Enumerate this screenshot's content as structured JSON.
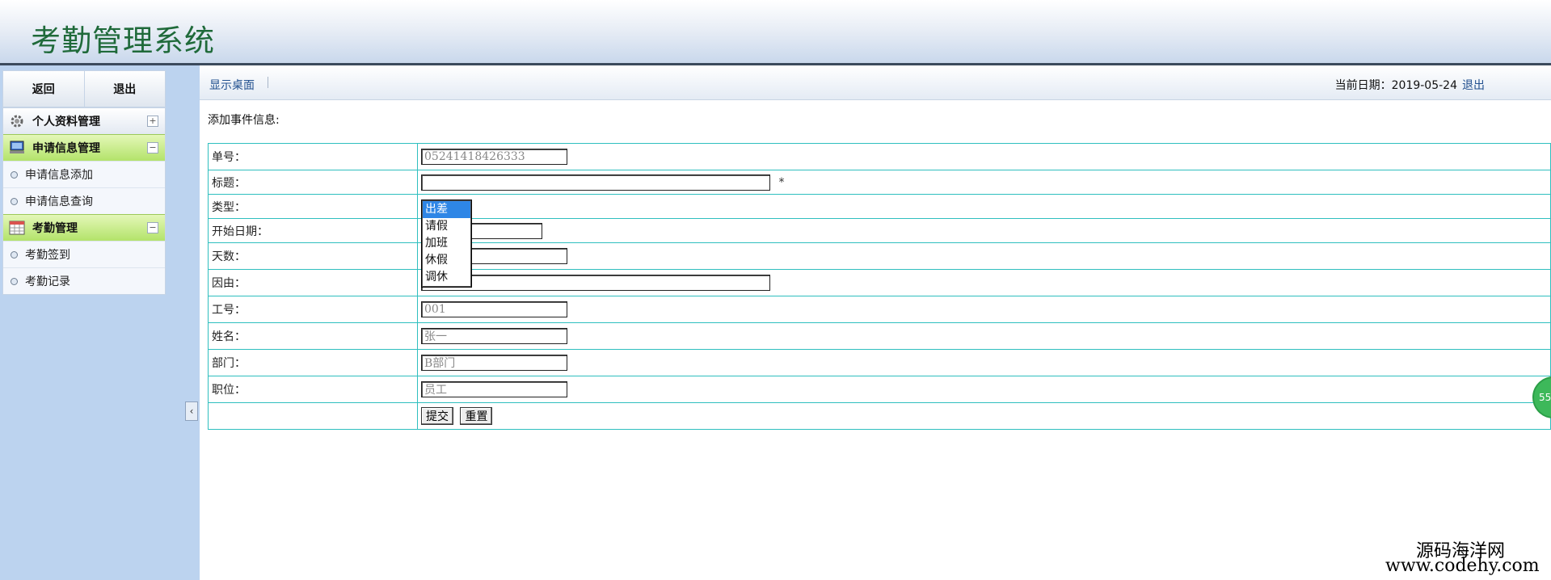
{
  "app": {
    "title": "考勤管理系统"
  },
  "sidebar": {
    "buttons": {
      "back": "返回",
      "exit": "退出"
    },
    "groups": [
      {
        "label": "个人资料管理",
        "icon": "gear-icon",
        "toggle": "+"
      },
      {
        "label": "申请信息管理",
        "icon": "computer-icon",
        "toggle": "−",
        "items": [
          "申请信息添加",
          "申请信息查询"
        ]
      },
      {
        "label": "考勤管理",
        "icon": "calendar-icon",
        "toggle": "−",
        "items": [
          "考勤签到",
          "考勤记录"
        ]
      }
    ],
    "collapse_handle": "‹"
  },
  "topbar": {
    "desktop_link": "显示桌面",
    "date_label": "当前日期：2019-05-24",
    "logout": "退出"
  },
  "form": {
    "section_title": "添加事件信息:",
    "fields": {
      "order_no": {
        "label": "单号：",
        "value": "05241418426333"
      },
      "title": {
        "label": "标题：",
        "value": "",
        "required_mark": "*"
      },
      "type": {
        "label": "类型："
      },
      "start_date": {
        "label": "开始日期：",
        "value": ""
      },
      "days": {
        "label": "天数：",
        "value": ""
      },
      "reason": {
        "label": "因由：",
        "value": ""
      },
      "emp_no": {
        "label": "工号：",
        "value": "001"
      },
      "name": {
        "label": "姓名：",
        "value": "张一"
      },
      "department": {
        "label": "部门：",
        "value": "B部门"
      },
      "position": {
        "label": "职位：",
        "value": "员工"
      }
    },
    "buttons": {
      "submit": "提交",
      "reset": "重置"
    }
  },
  "dropdown": {
    "options": [
      "出差",
      "请假",
      "加班",
      "休假",
      "调休"
    ],
    "selected": "出差"
  },
  "float_badge": "55",
  "watermark": {
    "line1": "源码海洋网",
    "line2": "www.codehy.com"
  }
}
